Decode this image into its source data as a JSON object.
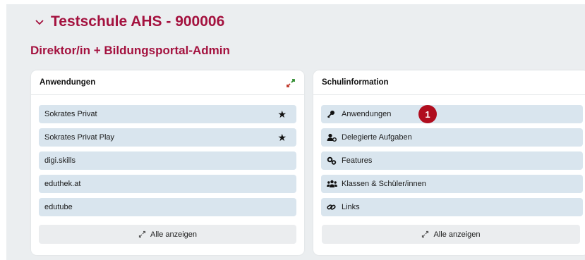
{
  "school": {
    "title": "Testschule AHS - 900006",
    "icon": "chevron-down-icon"
  },
  "role": {
    "title": "Direktor/in + Bildungsportal-Admin"
  },
  "apps_card": {
    "header": "Anwendungen",
    "items": [
      {
        "label": "Sokrates Privat",
        "favorite": true
      },
      {
        "label": "Sokrates Privat Play",
        "favorite": true
      },
      {
        "label": "digi.skills"
      },
      {
        "label": "eduthek.at"
      },
      {
        "label": "edutube"
      }
    ],
    "show_all": "Alle anzeigen"
  },
  "info_card": {
    "header": "Schulinformation",
    "items": [
      {
        "label": "Anwendungen",
        "icon": "key-icon"
      },
      {
        "label": "Delegierte Aufgaben",
        "icon": "user-gear-icon"
      },
      {
        "label": "Features",
        "icon": "gears-icon"
      },
      {
        "label": "Klassen & Schüler/innen",
        "icon": "users-icon"
      },
      {
        "label": "Links",
        "icon": "link-icon"
      }
    ],
    "badge": "1",
    "show_all": "Alle anzeigen"
  },
  "colors": {
    "accent": "#a4123f",
    "item_bg": "#d9e5ee",
    "badge": "#b00d1e"
  }
}
